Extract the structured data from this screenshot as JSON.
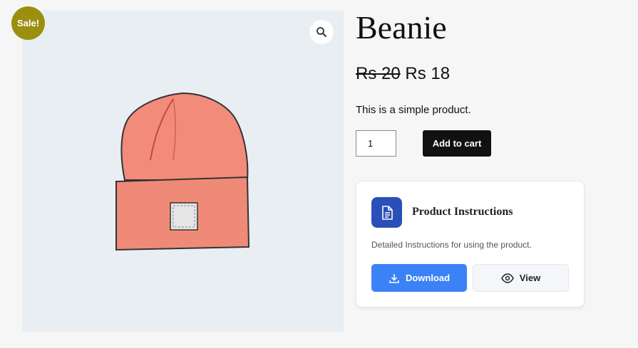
{
  "product": {
    "sale_badge": "Sale!",
    "title": "Beanie",
    "price_old": "Rs 20",
    "price_new": "Rs 18",
    "short_description": "This is a simple product.",
    "quantity": "1",
    "add_to_cart_label": "Add to cart"
  },
  "gallery": {
    "zoom_icon": "magnifier-icon",
    "image_subject": "beanie"
  },
  "instructions_card": {
    "icon": "document-icon",
    "title": "Product Instructions",
    "description": "Detailed Instructions for using the product.",
    "download_label": "Download",
    "view_label": "View"
  },
  "colors": {
    "sale_badge": "#9b8f10",
    "add_to_cart": "#111111",
    "download": "#3b82f6",
    "card_icon_bg": "#2a4fb8",
    "beanie": "#f08a78"
  }
}
